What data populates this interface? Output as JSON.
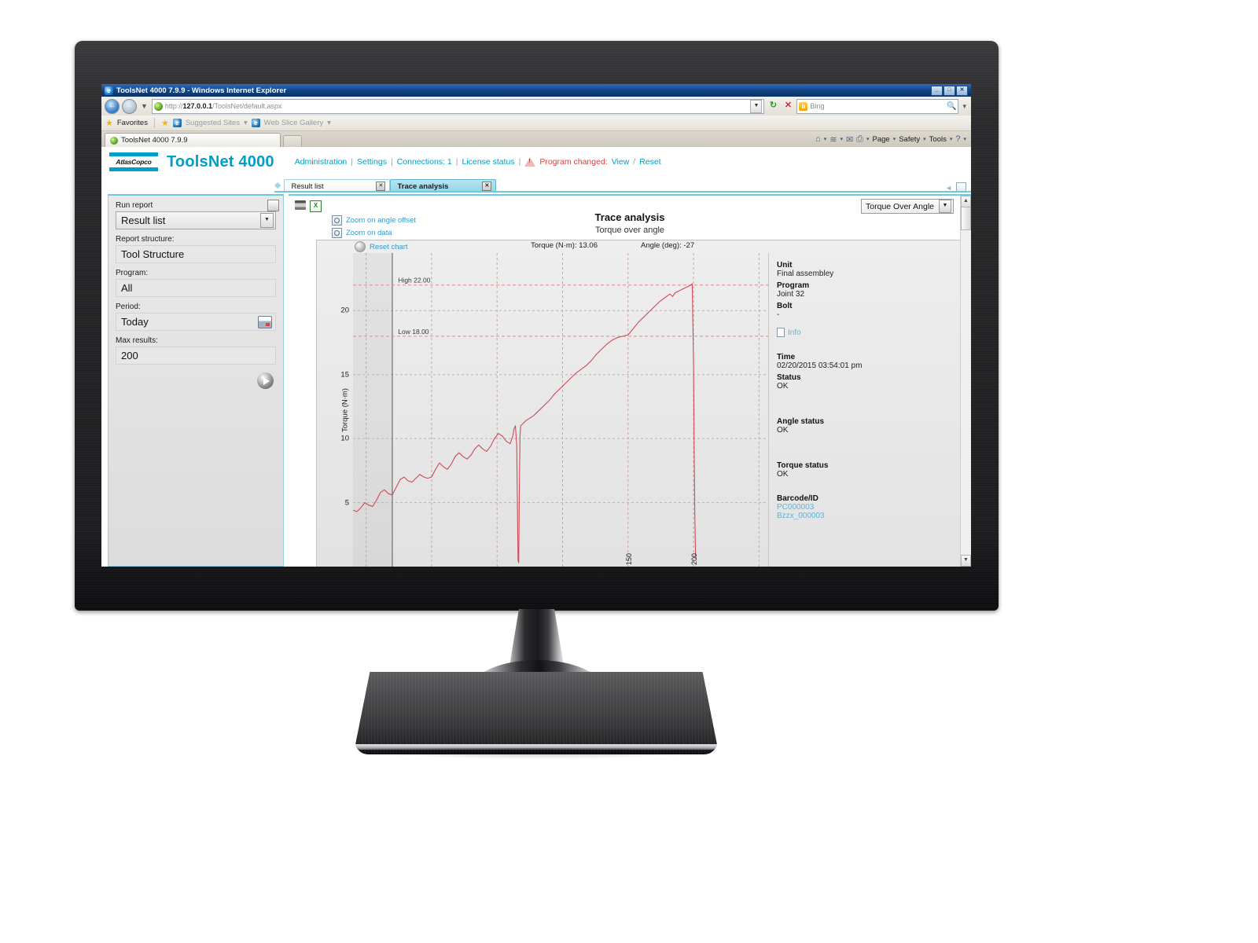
{
  "browser": {
    "window_title": "ToolsNet 4000 7.9.9 - Windows Internet Explorer",
    "min_label": "_",
    "max_label": "□",
    "close_label": "✕",
    "url_prefix": "http://",
    "url_host": "127.0.0.1",
    "url_path": "/ToolsNet/default.aspx",
    "url_dropdown": "▼",
    "refresh_label": "↻",
    "stop_label": "✕",
    "search_placeholder": "Bing",
    "search_go": "🔍",
    "favorites_label": "Favorites",
    "suggested_sites_label": "Suggested Sites",
    "web_slice_label": "Web Slice Gallery",
    "caret": "▾",
    "tab_label": "ToolsNet 4000 7.9.9",
    "commands": [
      {
        "icon": "home-icon",
        "label": "",
        "glyph": "⌂"
      },
      {
        "icon": "feeds-icon",
        "label": "",
        "glyph": "≋"
      },
      {
        "icon": "mail-icon",
        "label": "",
        "glyph": "✉"
      },
      {
        "icon": "print-icon",
        "label": "",
        "glyph": "⎙"
      },
      {
        "icon": "page-menu",
        "label": "Page",
        "glyph": ""
      },
      {
        "icon": "safety-menu",
        "label": "Safety",
        "glyph": ""
      },
      {
        "icon": "tools-menu",
        "label": "Tools",
        "glyph": ""
      },
      {
        "icon": "help-icon",
        "label": "",
        "glyph": "?"
      }
    ]
  },
  "app": {
    "brand_word": "AtlasCopco",
    "title": "ToolsNet 4000",
    "nav": [
      "Administration",
      "Settings",
      "Connections: 1",
      "License status"
    ],
    "separator": "|",
    "alert_text": "Program changed:",
    "alert_links": [
      "View",
      "Reset"
    ],
    "alert_link_sep": "/",
    "accent_color": "#00a0c6",
    "alert_color": "#e33b3b"
  },
  "tabs": {
    "items": [
      {
        "label": "Result list",
        "active": false,
        "close": "✕"
      },
      {
        "label": "Trace analysis",
        "active": true,
        "close": "✕"
      }
    ],
    "pin_icon": "◆"
  },
  "sidebar": {
    "run_report_label": "Run report",
    "run_report_value": "Result list",
    "report_structure_label": "Report structure:",
    "report_structure_value": "Tool Structure",
    "program_label": "Program:",
    "program_value": "All",
    "period_label": "Period:",
    "period_value": "Today",
    "max_results_label": "Max results:",
    "max_results_value": "200",
    "go_button": "▶",
    "caret": "▼"
  },
  "chart_panel": {
    "print_icon": "print-icon",
    "excel_icon": "excel-export-icon",
    "excel_glyph": "X",
    "zoom_links": [
      "Zoom on angle offset",
      "Zoom on data"
    ],
    "reset_chart": "Reset chart",
    "readout_torque": "Torque (N·m): 13.06",
    "readout_angle": "Angle (deg): -27",
    "view_select_value": "Torque Over Angle",
    "view_select_caret": "▼"
  },
  "info": {
    "unit_label": "Unit",
    "unit_value": "Final assembley",
    "program_label": "Program",
    "program_value": "Joint 32",
    "bolt_label": "Bolt",
    "bolt_value": "-",
    "info_link": "Info",
    "time_label": "Time",
    "time_value": "02/20/2015 03:54:01 pm",
    "status_label": "Status",
    "status_value": "OK",
    "angle_status_label": "Angle status",
    "angle_status_value": "OK",
    "torque_status_label": "Torque status",
    "torque_status_value": "OK",
    "barcode_label": "Barcode/ID",
    "barcode_values": [
      "PC000003",
      "Bzzx_000003"
    ]
  },
  "chart_data": {
    "type": "line",
    "title": "Trace analysis",
    "subtitle": "Torque over angle",
    "xlabel": "",
    "ylabel": "Torque (N·m)",
    "xlim": [
      -60,
      260
    ],
    "ylim": [
      0,
      24.5
    ],
    "yticks": [
      5,
      10,
      15,
      20
    ],
    "xticks": [
      150,
      200
    ],
    "grid": true,
    "legend": "none",
    "line_color": "#cf4a56",
    "limits": [
      {
        "name": "High 22.00",
        "value": 22.0,
        "color": "#e08b92"
      },
      {
        "name": "Low 18.00",
        "value": 18.0,
        "color": "#e08b92"
      }
    ],
    "series": [
      {
        "name": "Torque",
        "points": [
          [
            -60,
            4.4
          ],
          [
            -57,
            4.3
          ],
          [
            -54,
            4.6
          ],
          [
            -51,
            5.0
          ],
          [
            -48,
            4.8
          ],
          [
            -45,
            4.7
          ],
          [
            -42,
            5.2
          ],
          [
            -39,
            5.8
          ],
          [
            -36,
            6.0
          ],
          [
            -33,
            5.7
          ],
          [
            -30,
            5.6
          ],
          [
            -27,
            6.2
          ],
          [
            -24,
            6.8
          ],
          [
            -21,
            7.0
          ],
          [
            -18,
            6.7
          ],
          [
            -15,
            6.6
          ],
          [
            -12,
            6.9
          ],
          [
            -9,
            7.2
          ],
          [
            -6,
            7.0
          ],
          [
            -3,
            6.9
          ],
          [
            0,
            7.0
          ],
          [
            3,
            7.6
          ],
          [
            6,
            8.1
          ],
          [
            9,
            7.8
          ],
          [
            12,
            7.6
          ],
          [
            15,
            8.0
          ],
          [
            18,
            8.6
          ],
          [
            21,
            8.9
          ],
          [
            24,
            8.6
          ],
          [
            27,
            8.4
          ],
          [
            30,
            8.7
          ],
          [
            33,
            9.2
          ],
          [
            36,
            9.5
          ],
          [
            39,
            9.2
          ],
          [
            42,
            9.0
          ],
          [
            45,
            9.4
          ],
          [
            48,
            10.0
          ],
          [
            51,
            10.4
          ],
          [
            54,
            10.2
          ],
          [
            57,
            9.8
          ],
          [
            60,
            9.6
          ],
          [
            62,
            10.2
          ],
          [
            63,
            10.8
          ],
          [
            64,
            11.0
          ],
          [
            65,
            9.5
          ],
          [
            65.5,
            5.0
          ],
          [
            66,
            0.5
          ],
          [
            66.5,
            0.3
          ],
          [
            67,
            6.0
          ],
          [
            67.5,
            10.2
          ],
          [
            68,
            11.0
          ],
          [
            69,
            11.1
          ],
          [
            72,
            11.4
          ],
          [
            75,
            11.6
          ],
          [
            78,
            11.8
          ],
          [
            82,
            12.2
          ],
          [
            86,
            12.6
          ],
          [
            90,
            13.0
          ],
          [
            94,
            13.5
          ],
          [
            98,
            13.9
          ],
          [
            102,
            14.3
          ],
          [
            106,
            14.7
          ],
          [
            110,
            15.1
          ],
          [
            114,
            15.4
          ],
          [
            118,
            15.7
          ],
          [
            122,
            16.1
          ],
          [
            126,
            16.6
          ],
          [
            130,
            17.0
          ],
          [
            134,
            17.4
          ],
          [
            138,
            17.7
          ],
          [
            142,
            17.9
          ],
          [
            146,
            18.0
          ],
          [
            150,
            18.1
          ],
          [
            154,
            18.6
          ],
          [
            158,
            19.1
          ],
          [
            162,
            19.5
          ],
          [
            166,
            19.9
          ],
          [
            170,
            20.3
          ],
          [
            174,
            20.7
          ],
          [
            178,
            21.0
          ],
          [
            182,
            21.3
          ],
          [
            184,
            21.1
          ],
          [
            186,
            21.4
          ],
          [
            190,
            21.6
          ],
          [
            194,
            21.8
          ],
          [
            198,
            22.0
          ],
          [
            199,
            22.1
          ],
          [
            200,
            16.0
          ],
          [
            200.5,
            9.0
          ],
          [
            201,
            4.0
          ],
          [
            201.5,
            1.0
          ],
          [
            202,
            0.6
          ]
        ]
      }
    ]
  }
}
